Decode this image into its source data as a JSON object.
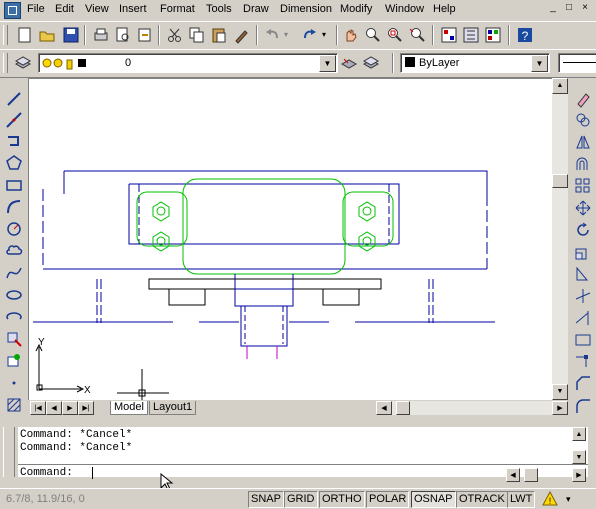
{
  "menubar": {
    "items": [
      "File",
      "Edit",
      "View",
      "Insert",
      "Format",
      "Tools",
      "Draw",
      "Dimension",
      "Modify",
      "Window",
      "Help"
    ],
    "minimize": "_",
    "restore": "□",
    "close": "×"
  },
  "layer_toolbar": {
    "layer_value": "0",
    "color_value": "ByLayer"
  },
  "tabs": [
    "Model",
    "Layout1"
  ],
  "command": {
    "history": [
      "Command: *Cancel*",
      "Command: *Cancel*"
    ],
    "prompt": "Command:"
  },
  "status": {
    "coords": "6.7/8,  11.9/16, 0",
    "buttons": [
      "SNAP",
      "GRID",
      "ORTHO",
      "POLAR",
      "OSNAP",
      "OTRACK",
      "LWT"
    ],
    "active": [
      "OSNAP"
    ]
  },
  "ucs": {
    "y": "Y",
    "x": "X"
  },
  "colors": {
    "outline": "#0000a0",
    "part": "#00c000",
    "magenta": "#c000c0",
    "canvas": "#ffffff"
  }
}
